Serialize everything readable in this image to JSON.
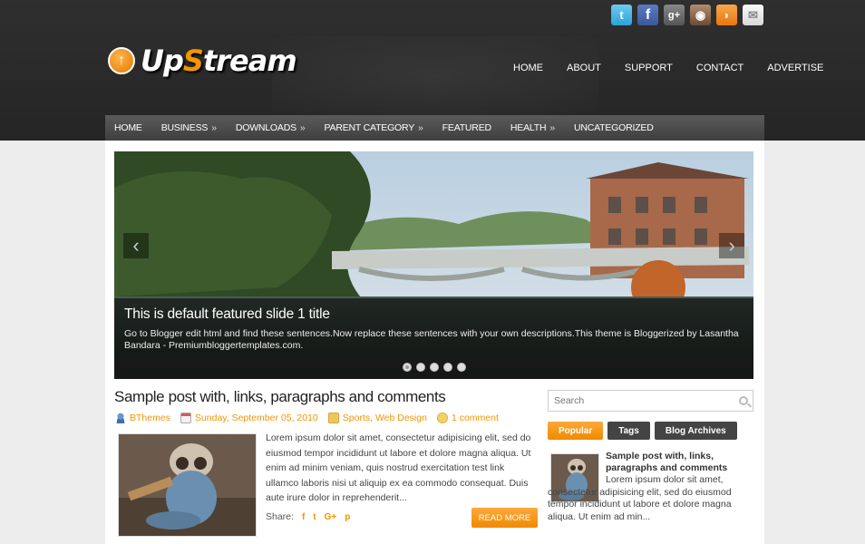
{
  "site": {
    "logo_prefix": "Up",
    "logo_s": "S",
    "logo_suffix": "tream"
  },
  "social_icons": [
    "twitter-icon",
    "facebook-icon",
    "google-plus-icon",
    "instagram-icon",
    "rss-icon",
    "mail-icon"
  ],
  "top_nav": [
    "HOME",
    "ABOUT",
    "SUPPORT",
    "CONTACT",
    "ADVERTISE"
  ],
  "main_nav": [
    {
      "label": "HOME",
      "arrow": ""
    },
    {
      "label": "BUSINESS",
      "arrow": "»"
    },
    {
      "label": "DOWNLOADS",
      "arrow": "»"
    },
    {
      "label": "PARENT CATEGORY",
      "arrow": "»"
    },
    {
      "label": "FEATURED",
      "arrow": ""
    },
    {
      "label": "HEALTH",
      "arrow": "»"
    },
    {
      "label": "UNCATEGORIZED",
      "arrow": ""
    }
  ],
  "slider": {
    "title": "This is default featured slide 1 title",
    "description": "Go to Blogger edit html and find these sentences.Now replace these sentences with your own descriptions.This theme is Bloggerized by Lasantha Bandara - Premiumbloggertemplates.com.",
    "active_slide": 1,
    "slide_count": 5
  },
  "post": {
    "title": "Sample post with, links, paragraphs and comments",
    "author": "BThemes",
    "date": "Sunday, September 05, 2010",
    "labels": "Sports, Web Design",
    "comments": "1 comment",
    "excerpt": "Lorem ipsum dolor sit amet, consectetur adipisicing elit, sed do eiusmod tempor incididunt ut labore et dolore magna aliqua. Ut enim ad minim veniam, quis nostrud exercitation test link ullamco laboris nisi ut aliquip ex ea commodo consequat. Duis aute irure dolor in reprehenderit...",
    "share_label": "Share:",
    "share_icons": [
      "f",
      "t",
      "G+",
      "p"
    ],
    "read_more": "READ MORE"
  },
  "sidebar": {
    "search_placeholder": "Search",
    "tabs": [
      "Popular",
      "Tags",
      "Blog Archives"
    ],
    "popular_post": {
      "title": "Sample post with, links, paragraphs and comments",
      "text": "Lorem ipsum dolor sit amet, consectetur adipisicing elit, sed do eiusmod tempor incididunt ut labore et dolore magna aliqua. Ut enim ad min..."
    }
  },
  "colors": {
    "accent": "#f39400",
    "header_bg": "#2a2a2a",
    "nav_bg": "#4a4a4a"
  }
}
